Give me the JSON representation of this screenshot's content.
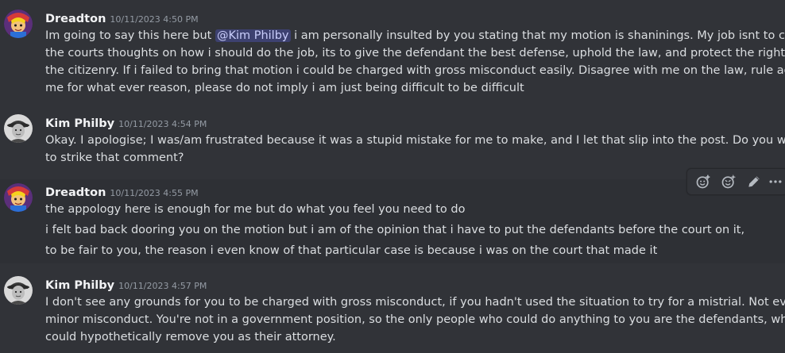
{
  "messages": [
    {
      "author": "Dreadton",
      "timestamp": "10/11/2023 4:50 PM",
      "lines": [
        {
          "pre": "Im going to say this here but ",
          "mention": "@Kim Philby",
          "post": " i am personally insulted by you stating that my motion is shaninings.  My job isnt to cater to"
        },
        {
          "text": "the courts thoughts on how i should do the job, its to give the defendant the best defense, uphold the law, and protect the rights of"
        },
        {
          "text": "the citizenry. If i failed to bring that motion i could be charged with gross misconduct easily.  Disagree with me on the law, rule against"
        },
        {
          "text": "me for what ever reason, please do not imply i am just being difficult to be difficult"
        }
      ]
    },
    {
      "author": "Kim Philby",
      "timestamp": "10/11/2023 4:54 PM",
      "lines": [
        {
          "text": "Okay. I apologise; I was/am frustrated because it was a stupid mistake for me to make, and I let that slip into the post. Do you want me"
        },
        {
          "text": "to strike that comment?"
        }
      ]
    },
    {
      "author": "Dreadton",
      "timestamp": "10/11/2023 4:55 PM",
      "lines": [
        {
          "text": "the appology here is enough for me but do what you feel you need to do"
        },
        {
          "text": "i felt bad back dooring you on the motion but i am of the opinion that i have to put the defendants before the court on it,"
        },
        {
          "text": "to be fair to you, the reason i even know of that particular case is because i was on the court that made it"
        }
      ]
    },
    {
      "author": "Kim Philby",
      "timestamp": "10/11/2023 4:57 PM",
      "lines": [
        {
          "text": "I don't see any grounds for you to be charged with gross misconduct, if you hadn't used the situation to try for a mistrial. Not even"
        },
        {
          "text": "minor misconduct. You're not in a government position, so the only people who could do anything to you are the defendants, who"
        },
        {
          "text": "could hypothetically remove you as their attorney."
        }
      ]
    }
  ],
  "toolbar": {
    "icons": [
      "add-reaction-icon",
      "super-reaction-icon",
      "edit-pencil-icon",
      "more-options-icon"
    ]
  }
}
